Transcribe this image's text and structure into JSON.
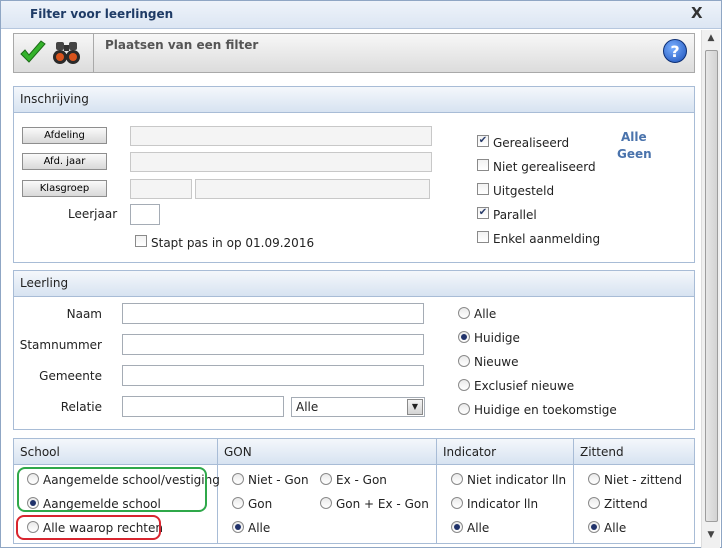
{
  "window": {
    "title": "Filter voor leerlingen",
    "close_label": "X"
  },
  "toolbar": {
    "subtitle": "Plaatsen van een filter",
    "help_label": "?"
  },
  "inschrijving": {
    "header": "Inschrijving",
    "buttons": {
      "afdeling": "Afdeling",
      "afd_jaar": "Afd. jaar",
      "klasgroep": "Klasgroep"
    },
    "leerjaar_label": "Leerjaar",
    "stapt_pas_in_label": "Stapt pas in op 01.09.2016",
    "statuses": [
      {
        "label": "Gerealiseerd",
        "checked": true
      },
      {
        "label": "Niet gerealiseerd",
        "checked": false
      },
      {
        "label": "Uitgesteld",
        "checked": false
      },
      {
        "label": "Parallel",
        "checked": true
      },
      {
        "label": "Enkel aanmelding",
        "checked": false
      }
    ],
    "link_alle": "Alle",
    "link_geen": "Geen"
  },
  "leerling": {
    "header": "Leerling",
    "fields": {
      "naam": "Naam",
      "stamnummer": "Stamnummer",
      "gemeente": "Gemeente",
      "relatie": "Relatie"
    },
    "relatie_select": "Alle",
    "options": [
      {
        "label": "Alle",
        "selected": false
      },
      {
        "label": "Huidige",
        "selected": true
      },
      {
        "label": "Nieuwe",
        "selected": false
      },
      {
        "label": "Exclusief nieuwe",
        "selected": false
      },
      {
        "label": "Huidige en toekomstige",
        "selected": false
      }
    ]
  },
  "school": {
    "header": "School",
    "options": [
      {
        "label": "Aangemelde school/vestiging",
        "selected": false
      },
      {
        "label": "Aangemelde school",
        "selected": true
      },
      {
        "label": "Alle waarop rechten",
        "selected": false
      }
    ]
  },
  "gon": {
    "header": "GON",
    "options": [
      {
        "label": "Niet - Gon",
        "selected": false
      },
      {
        "label": "Ex - Gon",
        "selected": false
      },
      {
        "label": "Gon",
        "selected": false
      },
      {
        "label": "Gon + Ex - Gon",
        "selected": false
      },
      {
        "label": "Alle",
        "selected": true
      }
    ]
  },
  "indicator": {
    "header": "Indicator",
    "options": [
      {
        "label": "Niet indicator lln",
        "selected": false
      },
      {
        "label": "Indicator lln",
        "selected": false
      },
      {
        "label": "Alle",
        "selected": true
      }
    ]
  },
  "zittend": {
    "header": "Zittend",
    "options": [
      {
        "label": "Niet - zittend",
        "selected": false
      },
      {
        "label": "Zittend",
        "selected": false
      },
      {
        "label": "Alle",
        "selected": true
      }
    ]
  },
  "colors": {
    "title": "#1f3b66",
    "link": "#4a73ac",
    "highlight_green": "#2fa84a",
    "highlight_red": "#d8252f"
  },
  "icons": {
    "confirm": "checkmark-icon",
    "search": "binoculars-icon",
    "help": "help-icon"
  }
}
